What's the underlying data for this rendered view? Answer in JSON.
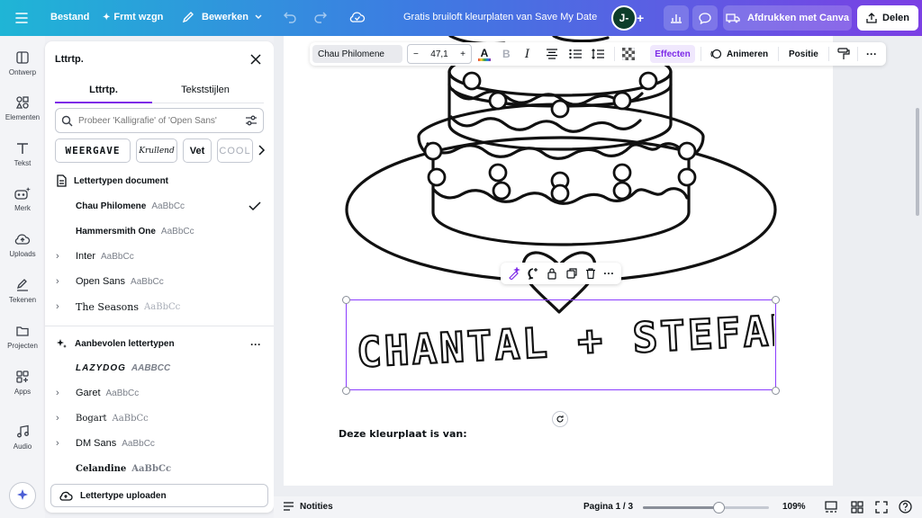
{
  "topbar": {
    "file_label": "Bestand",
    "resize_label": "Frmt wzgn",
    "edit_label": "Bewerken",
    "doc_title": "Gratis bruiloft kleurplaten van Save My Date",
    "avatar_initials": "J-",
    "print_label": "Afdrukken met Canva",
    "share_label": "Delen"
  },
  "rail": {
    "items": [
      {
        "label": "Ontwerp",
        "icon": "layout-icon"
      },
      {
        "label": "Elementen",
        "icon": "shapes-icon"
      },
      {
        "label": "Tekst",
        "icon": "text-icon"
      },
      {
        "label": "Merk",
        "icon": "brand-icon"
      },
      {
        "label": "Uploads",
        "icon": "cloud-upload-icon"
      },
      {
        "label": "Tekenen",
        "icon": "pen-icon"
      },
      {
        "label": "Projecten",
        "icon": "folder-icon"
      },
      {
        "label": "Apps",
        "icon": "apps-icon"
      },
      {
        "label": "Audio",
        "icon": "music-icon"
      }
    ]
  },
  "panel": {
    "title": "Lttrtp.",
    "tabs": [
      "Lttrtp.",
      "Tekststijlen"
    ],
    "search_placeholder": "Probeer 'Kalligrafie' of 'Open Sans'",
    "chips": [
      "WEERGAVE",
      "Krullend",
      "Vet",
      "COOL"
    ],
    "doc_fonts_heading": "Lettertypen document",
    "doc_fonts": [
      {
        "name": "Chau Philomene",
        "sample": "AaBbCc",
        "checked": true
      },
      {
        "name": "Hammersmith One",
        "sample": "AaBbCc",
        "checked": false
      },
      {
        "name": "Inter",
        "sample": "AaBbCc",
        "checked": false
      },
      {
        "name": "Open Sans",
        "sample": "AaBbCc",
        "checked": false
      },
      {
        "name": "The Seasons",
        "sample": "AaBbCc",
        "checked": false
      }
    ],
    "recommended_heading": "Aanbevolen lettertypen",
    "recommended_fonts": [
      {
        "name": "LAZYDOG",
        "sample": "AABBCC"
      },
      {
        "name": "Garet",
        "sample": "AaBbCc"
      },
      {
        "name": "Bogart",
        "sample": "AaBbCc"
      },
      {
        "name": "DM Sans",
        "sample": "AaBbCc"
      },
      {
        "name": "Celandine",
        "sample": "AaBbCc"
      }
    ],
    "upload_label": "Lettertype uploaden"
  },
  "text_toolbar": {
    "font_name": "Chau Philomene",
    "font_size": "47,1",
    "effects_label": "Effecten",
    "animate_label": "Animeren",
    "position_label": "Positie",
    "accent_color": "#7d2ae8"
  },
  "canvas": {
    "names_text": "CHANTAL + STEFAN",
    "owner_text": "Deze kleurplaat is van:"
  },
  "bottombar": {
    "notes_label": "Notities",
    "page_label": "Pagina 1 / 3",
    "zoom_label": "109%",
    "zoom_fraction": 0.6
  }
}
